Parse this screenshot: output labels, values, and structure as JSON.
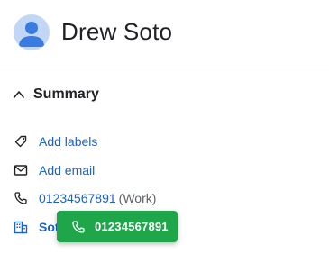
{
  "contact": {
    "name": "Drew Soto",
    "avatar_icon": "person-avatar-icon"
  },
  "summary": {
    "title": "Summary",
    "toggle_icon": "chevron-up-icon",
    "rows": [
      {
        "icon": "tag-icon",
        "label": "Add labels"
      },
      {
        "icon": "mail-icon",
        "label": "Add email"
      },
      {
        "icon": "phone-icon",
        "label": "01234567891",
        "suffix": "(Work)"
      },
      {
        "icon": "building-icon",
        "label": "Sot"
      }
    ]
  },
  "call_popup": {
    "icon": "phone-icon",
    "number": "01234567891",
    "color": "#1fa64a"
  },
  "colors": {
    "link": "#1a62c6",
    "text": "#202124",
    "muted": "#5f6368",
    "avatar_bg": "#c2d7f5",
    "avatar_fg": "#3a7be0"
  }
}
